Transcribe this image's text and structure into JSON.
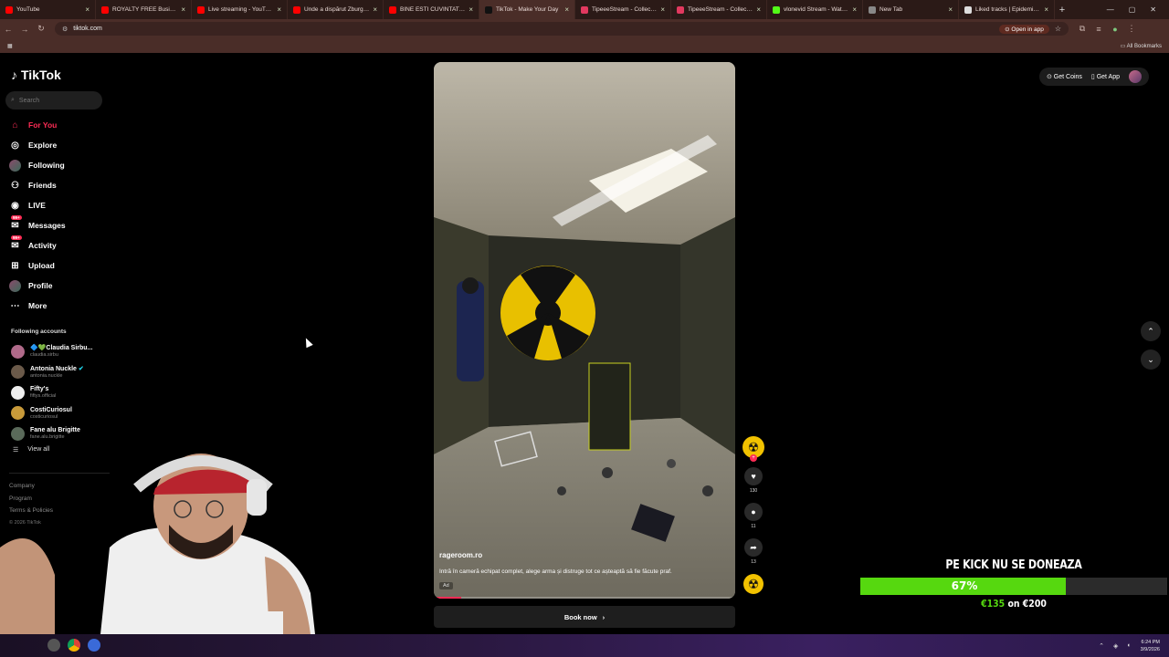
{
  "browser": {
    "tabs": [
      {
        "title": "YouTube",
        "color": "#ff0000"
      },
      {
        "title": "ROYALTY FREE Business M...",
        "color": "#ff0000"
      },
      {
        "title": "Live streaming - YouTube...",
        "color": "#ff0000"
      },
      {
        "title": "Unde a dispărut Zburgeri...",
        "color": "#ff0000"
      },
      {
        "title": "BINE ESTI CUVINTAT DO...",
        "color": "#ff0000"
      },
      {
        "title": "TikTok - Make Your Day",
        "color": "#111111",
        "active": true
      },
      {
        "title": "TipeeeStream - Collect Tip...",
        "color": "#e2395f"
      },
      {
        "title": "TipeeeStream - Collect Tip...",
        "color": "#e2395f"
      },
      {
        "title": "vlonevid Stream - Watch...",
        "color": "#53fc18"
      },
      {
        "title": "New Tab",
        "color": "#888888"
      },
      {
        "title": "Liked tracks | Epidemic Sou...",
        "color": "#dddddd"
      }
    ],
    "url": "tiktok.com",
    "open_in_app": "Open in app",
    "all_bookmarks": "All Bookmarks"
  },
  "tiktok": {
    "logo": "TikTok",
    "search_placeholder": "Search",
    "nav": [
      {
        "label": "For You",
        "icon": "home-icon",
        "active": true
      },
      {
        "label": "Explore",
        "icon": "compass-icon"
      },
      {
        "label": "Following",
        "icon": "following-avatar"
      },
      {
        "label": "Friends",
        "icon": "friends-icon"
      },
      {
        "label": "LIVE",
        "icon": "live-icon"
      },
      {
        "label": "Messages",
        "icon": "messages-icon",
        "badge": "99+"
      },
      {
        "label": "Activity",
        "icon": "activity-icon",
        "badge": "99+"
      },
      {
        "label": "Upload",
        "icon": "upload-icon"
      },
      {
        "label": "Profile",
        "icon": "profile-avatar"
      },
      {
        "label": "More",
        "icon": "more-icon"
      }
    ],
    "following_title": "Following accounts",
    "accounts": [
      {
        "name": "🔷💚Claudia Sirbu...",
        "handle": "claudia.sirbu",
        "color": "#b06a8a"
      },
      {
        "name": "Antonia Nuckle",
        "handle": "antonia.nuckle",
        "verified": true,
        "color": "#6b5a4a"
      },
      {
        "name": "Fifty's",
        "handle": "fiftys.official",
        "color": "#eeeeee"
      },
      {
        "name": "CostiCuriosul",
        "handle": "costicuriosul",
        "color": "#c89a3a"
      },
      {
        "name": "Fane alu Brigitte",
        "handle": "fane.alu.brigitte",
        "color": "#5a6a5a"
      }
    ],
    "view_all": "View all",
    "footer": [
      "Company",
      "Program",
      "Terms & Policies"
    ],
    "copyright": "© 2026 TikTok",
    "get_coins": "Get Coins",
    "get_app": "Get App",
    "video": {
      "username": "rageroom.ro",
      "description": "Intră în cameră echipat complet, alege arma și distruge tot ce așteaptă să fie făcute praf.",
      "ad_label": "Ad",
      "progress": 0.09
    },
    "book_now": "Book now",
    "actions": {
      "likes": "130",
      "comments": "11",
      "shares": "13"
    }
  },
  "overlay": {
    "title": "PE KICK NU SE DONEAZA",
    "percent_label": "67%",
    "progress": 0.67,
    "raised": "€135",
    "on": "on",
    "goal": "€200"
  },
  "taskbar": {
    "time": "6:24 PM",
    "date": "3/9/2026"
  }
}
